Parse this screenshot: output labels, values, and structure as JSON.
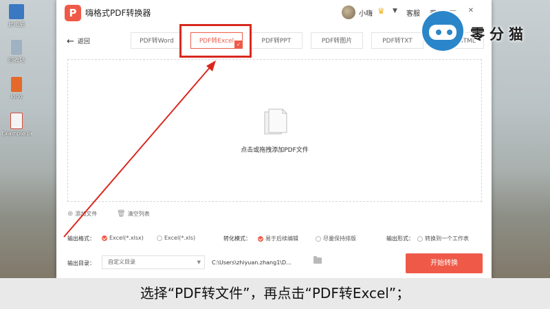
{
  "desktop": {
    "icons": [
      {
        "label": "此电脑",
        "icon": "computer-icon",
        "color": "#3a78c2"
      },
      {
        "label": "回收站",
        "icon": "recycle-bin-icon",
        "color": "#9fb2c2"
      },
      {
        "label": "logo",
        "icon": "image-file-icon",
        "color": "#e56a2a"
      },
      {
        "label": "Example.pdf",
        "icon": "pdf-file-icon",
        "color": "#d84a3a"
      }
    ]
  },
  "app": {
    "title": "嗨格式PDF转换器",
    "logo_glyph": "P",
    "user": {
      "name": "小嗨"
    },
    "service_label": "客服",
    "menu_label": "菜单",
    "back_label": "返回",
    "tabs": [
      {
        "label": "PDF转Word",
        "active": false
      },
      {
        "label": "PDF转Excel",
        "active": true
      },
      {
        "label": "PDF转PPT",
        "active": false
      },
      {
        "label": "PDF转图片",
        "active": false
      },
      {
        "label": "PDF转TXT",
        "active": false
      },
      {
        "label": "PDF转HTML",
        "active": false
      }
    ],
    "dropzone_text": "点击或拖拽添加PDF文件",
    "add_file_label": "添加文件",
    "clear_list_label": "清空列表",
    "output_format": {
      "label": "输出格式：",
      "options": [
        {
          "label": "Excel(*.xlsx)",
          "selected": true
        },
        {
          "label": "Excel(*.xls)",
          "selected": false
        }
      ]
    },
    "convert_mode": {
      "label": "转化模式：",
      "options": [
        {
          "label": "易于后续编辑",
          "selected": true
        },
        {
          "label": "尽量保持排版",
          "selected": false
        }
      ]
    },
    "output_form": {
      "label": "输出形式：",
      "option": {
        "label": "转换到一个工作表",
        "selected": false
      }
    },
    "output_dir": {
      "label": "输出目录：",
      "selected": "自定义目录",
      "path": "C:\\Users\\zhiyuan.zhang1\\D..."
    },
    "start_label": "开始转换",
    "accent_color": "#ef5a48"
  },
  "watermark": {
    "text": "零分猫"
  },
  "caption": "选择“PDF转文件”，再点击“PDF转Excel”；"
}
